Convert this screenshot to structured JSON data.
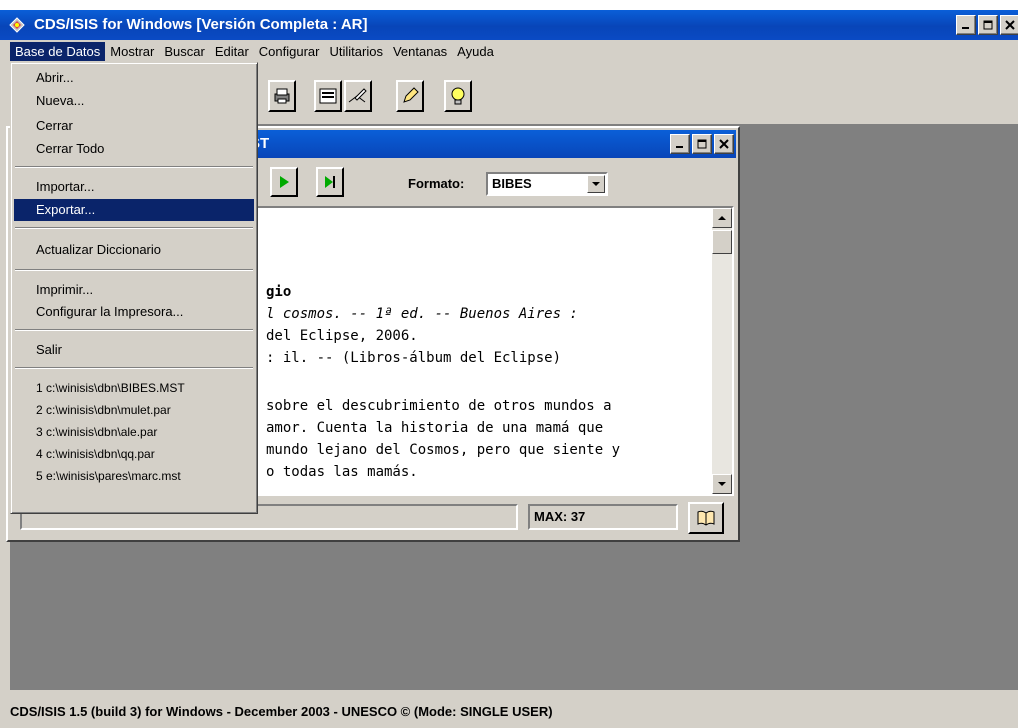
{
  "window": {
    "title": "CDS/ISIS for Windows [Versión Completa : AR]",
    "controls": [
      "_",
      "□",
      "x"
    ]
  },
  "menubar": {
    "items": [
      "Base de Datos",
      "Mostrar",
      "Buscar",
      "Editar",
      "Configurar",
      "Utilitarios",
      "Ventanas",
      "Ayuda"
    ],
    "active": "Base de Datos"
  },
  "dropdown": {
    "items": [
      {
        "label": "Abrir..."
      },
      {
        "label": "Nueva..."
      },
      {
        "label": "Cerrar"
      },
      {
        "label": "Cerrar Todo"
      },
      {
        "label": "Importar..."
      },
      {
        "label": "Exportar...",
        "selected": true
      },
      {
        "label": "Actualizar Diccionario"
      },
      {
        "label": "Imprimir..."
      },
      {
        "label": "Configurar la Impresora..."
      },
      {
        "label": "Salir"
      },
      {
        "label": "1 c:\\winisis\\dbn\\BIBES.MST"
      },
      {
        "label": "2 c:\\winisis\\dbn\\mulet.par"
      },
      {
        "label": "3 c:\\winisis\\dbn\\ale.par"
      },
      {
        "label": "4 c:\\winisis\\dbn\\qq.par"
      },
      {
        "label": "5 e:\\winisis\\pares\\marc.mst"
      }
    ]
  },
  "child": {
    "title": "ST",
    "formato_label": "Formato:",
    "formato_value": "BIBES",
    "content_lines": [
      "gio",
      "l cosmos. -- 1ª ed. -- Buenos Aires :",
      " del Eclipse, 2006.",
      " : il. -- (Libros-álbum del Eclipse)",
      "sobre el descubrimiento de otros mundos a",
      "amor. Cuenta la historia de una mamá que",
      "mundo lejano del Cosmos, pero que siente y",
      "o todas las mamás."
    ],
    "max_label": "MAX: 37"
  },
  "status": {
    "text": "CDS/ISIS 1.5 (build 3) for Windows - December 2003 - UNESCO © (Mode: SINGLE USER)"
  },
  "colors": {
    "titlebar": "#0845b8",
    "menu_highlight": "#0a246a",
    "workspace": "#808080",
    "chrome": "#d4d0c8"
  }
}
